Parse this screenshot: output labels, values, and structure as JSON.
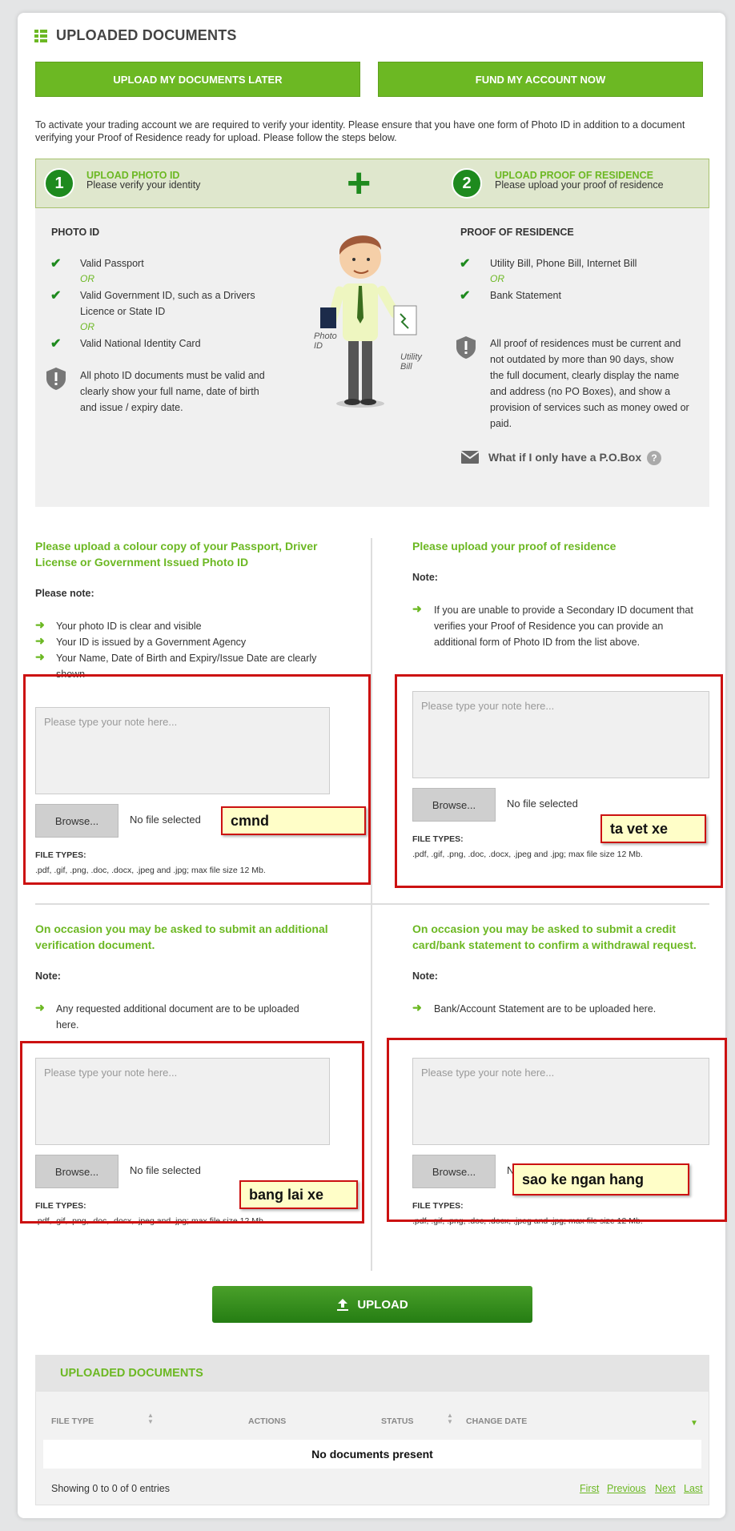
{
  "header": {
    "title": "UPLOADED DOCUMENTS"
  },
  "buttons": {
    "later": "UPLOAD MY DOCUMENTS LATER",
    "fund": "FUND MY ACCOUNT NOW"
  },
  "intro": "To activate your trading account we are required to verify your identity. Please ensure that you have one form of Photo ID in addition to a document verifying your Proof of Residence ready for upload. Please follow the steps below.",
  "steps": [
    {
      "num": "1",
      "title": "UPLOAD PHOTO ID",
      "sub": "Please verify your identity"
    },
    {
      "num": "2",
      "title": "UPLOAD PROOF OF RESIDENCE",
      "sub": "Please upload your proof of residence"
    }
  ],
  "plus_sign": "+",
  "photo_id": {
    "heading": "PHOTO ID",
    "items": [
      "Valid Passport",
      "Valid Government ID, such as a Drivers",
      "Licence or State ID",
      "Valid National Identity Card"
    ],
    "or": "OR",
    "notice": [
      "All photo ID documents must be valid and",
      "clearly show your full name, date of birth",
      "and issue / expiry date."
    ]
  },
  "illustration": {
    "label_photo": "Photo ID",
    "label_bill": "Utility Bill"
  },
  "residence": {
    "heading": "PROOF OF RESIDENCE",
    "items": [
      "Utility Bill, Phone Bill, Internet Bill",
      "Bank Statement"
    ],
    "or": "OR",
    "notice": [
      "All proof of residences must be current and",
      "not outdated by more than 90 days, show",
      "the full document, clearly display the name",
      "and address (no PO Boxes), and show a",
      "provision of services such as money owed or",
      "paid."
    ],
    "pobox": "What if I only have a P.O.Box"
  },
  "upload_sections": [
    {
      "title": [
        "Please upload a colour copy of your Passport, Driver",
        "License or Government Issued Photo ID"
      ],
      "note_head": "Please note:",
      "bullets": [
        "Your photo ID is clear and visible",
        "Your ID is issued by a Government Agency",
        "Your Name, Date of Birth and Expiry/Issue Date are clearly",
        "shown"
      ]
    },
    {
      "title": [
        "Please upload your proof of residence"
      ],
      "note_head": "Note:",
      "bullets": [
        "If you are unable to provide a Secondary ID document that",
        "verifies your Proof of Residence you can provide an",
        "additional form of Photo ID from the list above."
      ]
    },
    {
      "title": [
        "On occasion you may be asked to submit an additional",
        "verification document."
      ],
      "note_head": "Note:",
      "bullets": [
        "Any requested additional document are to be uploaded",
        "here."
      ]
    },
    {
      "title": [
        "On occasion you may be asked to submit a credit",
        "card/bank statement to confirm a withdrawal request."
      ],
      "note_head": "Note:",
      "bullets": [
        "Bank/Account Statement are to be uploaded here."
      ]
    }
  ],
  "form": {
    "placeholder": "Please type your note here...",
    "browse": "Browse...",
    "no_file": "No file selected",
    "no_file_short": "N",
    "file_types_head": "FILE TYPES:",
    "file_types": ".pdf, .gif, .png, .doc, .docx, .jpeg and .jpg; max file size 12 Mb."
  },
  "annotations": [
    "cmnd",
    "ta vet xe",
    "bang lai xe",
    "sao ke ngan hang"
  ],
  "upload_button": "UPLOAD",
  "docs_table": {
    "title": "UPLOADED DOCUMENTS",
    "columns": [
      "FILE TYPE",
      "ACTIONS",
      "STATUS",
      "CHANGE DATE"
    ],
    "empty": "No documents present",
    "showing": "Showing 0 to 0 of 0 entries",
    "pagination": [
      "First",
      "Previous",
      "Next",
      "Last"
    ]
  },
  "colors": {
    "accent_green": "#6cb823",
    "dark_green": "#1e8a1e",
    "annotation_red": "#cc1111"
  }
}
